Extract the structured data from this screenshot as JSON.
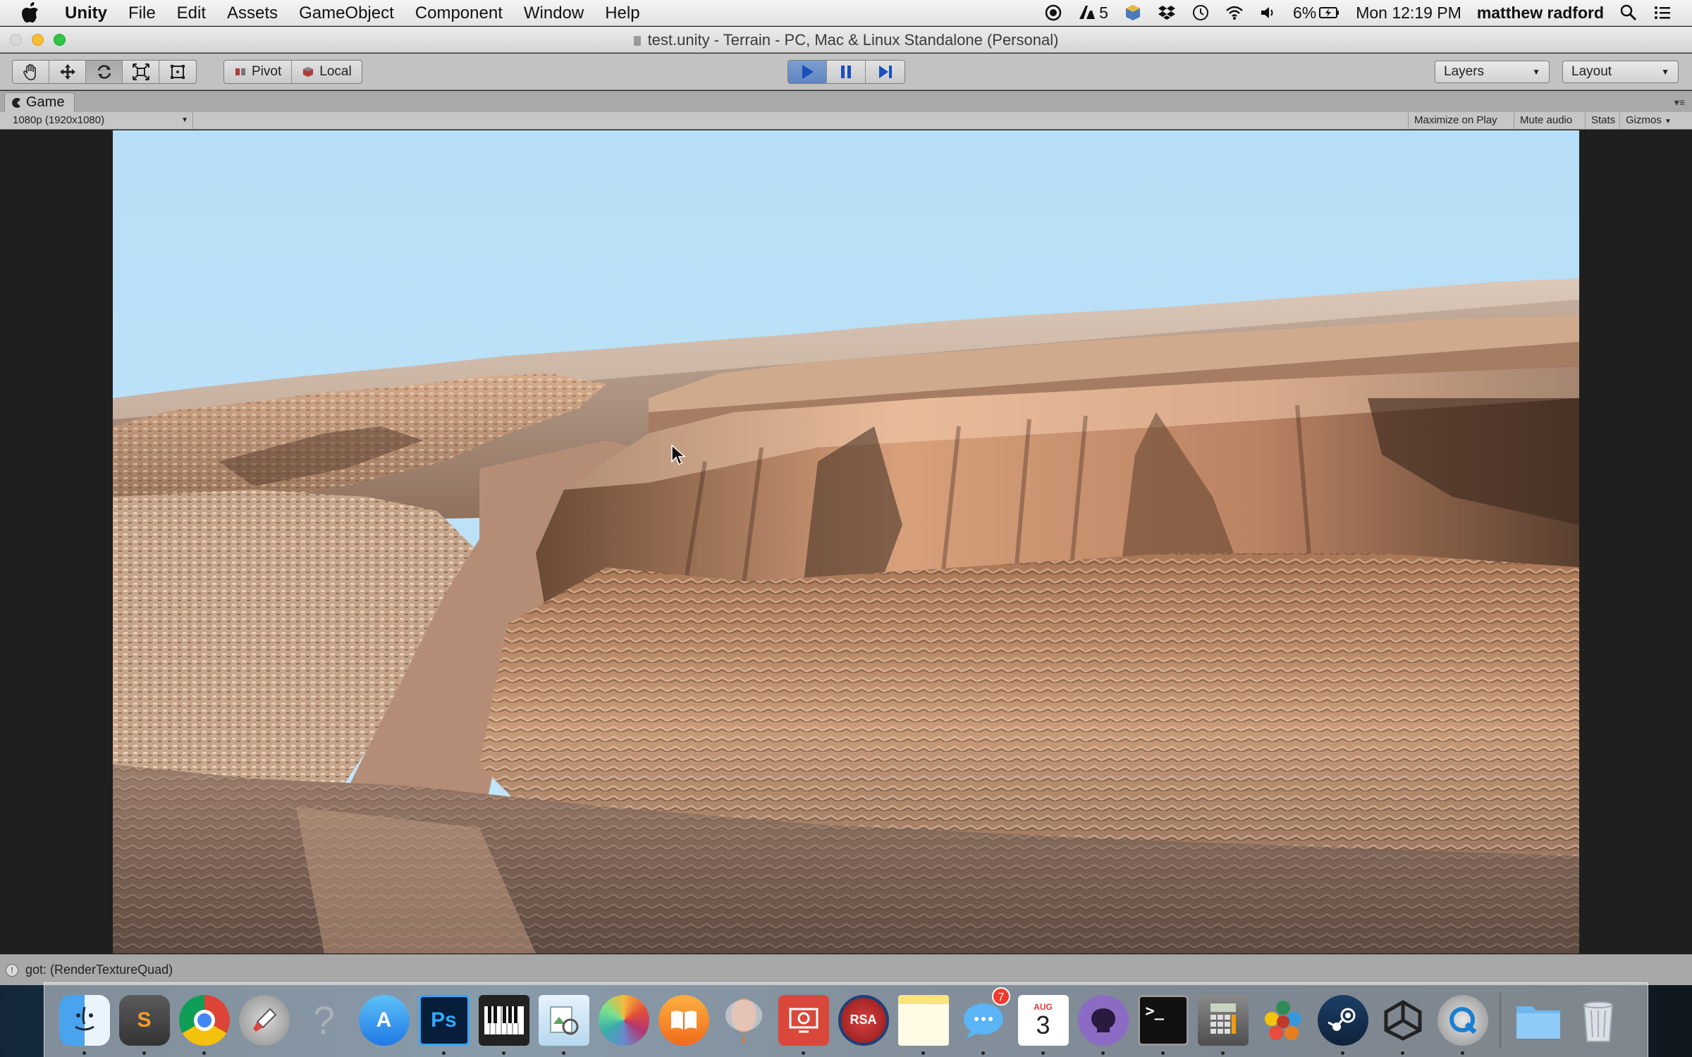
{
  "menubar": {
    "app_name": "Unity",
    "items": [
      "File",
      "Edit",
      "Assets",
      "GameObject",
      "Component",
      "Window",
      "Help"
    ],
    "status": {
      "adobe_count": "5",
      "battery": "6%",
      "clock": "Mon 12:19 PM",
      "user": "matthew radford"
    }
  },
  "window": {
    "title": "test.unity - Terrain - PC, Mac & Linux Standalone (Personal)"
  },
  "toolbar": {
    "pivot_label": "Pivot",
    "local_label": "Local",
    "layers_label": "Layers",
    "layout_label": "Layout",
    "play_state": "playing"
  },
  "game_tab": {
    "label": "Game",
    "resolution": "1080p (1920x1080)",
    "maximize_label": "Maximize on Play",
    "mute_label": "Mute audio",
    "stats_label": "Stats",
    "gizmos_label": "Gizmos"
  },
  "console": {
    "message": "got: (RenderTextureQuad)"
  },
  "dock": {
    "apps": [
      {
        "icon": "finder-icon",
        "label": "Finder"
      },
      {
        "icon": "sublime-text-icon",
        "label": "S"
      },
      {
        "icon": "chrome-icon",
        "label": "Chrome"
      },
      {
        "icon": "launchpad-icon",
        "label": "Launchpad"
      },
      {
        "icon": "help-icon",
        "label": "?"
      },
      {
        "icon": "app-store-icon",
        "label": "A"
      },
      {
        "icon": "photoshop-icon",
        "label": "Ps"
      },
      {
        "icon": "piano-icon",
        "label": "Piano"
      },
      {
        "icon": "preview-icon",
        "label": "Preview"
      },
      {
        "icon": "photos-icon",
        "label": "Photos"
      },
      {
        "icon": "ibooks-icon",
        "label": "iBooks"
      },
      {
        "icon": "balloon-icon",
        "label": "Balloon"
      },
      {
        "icon": "remote-desktop-icon",
        "label": "Remote"
      },
      {
        "icon": "rsa-securid-icon",
        "label": "RSA"
      },
      {
        "icon": "notes-icon",
        "label": "Notes"
      },
      {
        "icon": "messages-icon",
        "label": "Messages",
        "badge": "7"
      },
      {
        "icon": "calendar-icon",
        "label": "3",
        "month": "AUG"
      },
      {
        "icon": "github-icon",
        "label": "GitHub"
      },
      {
        "icon": "terminal-icon",
        "label": ">_"
      },
      {
        "icon": "calculator-icon",
        "label": "Calc"
      },
      {
        "icon": "molecules-icon",
        "label": "Molecules"
      },
      {
        "icon": "steam-icon",
        "label": "Steam"
      },
      {
        "icon": "unity-icon",
        "label": "Unity"
      },
      {
        "icon": "quicktime-icon",
        "label": "QuickTime"
      }
    ],
    "folder_icon": "downloads-folder-icon",
    "trash_icon": "trash-icon"
  },
  "colors": {
    "sky": "#bde3f8",
    "rock_light": "#d9a37f",
    "rock_dark": "#4a3528",
    "valley_floor": "#b78f7a",
    "play_active": "#6b8fc9"
  }
}
